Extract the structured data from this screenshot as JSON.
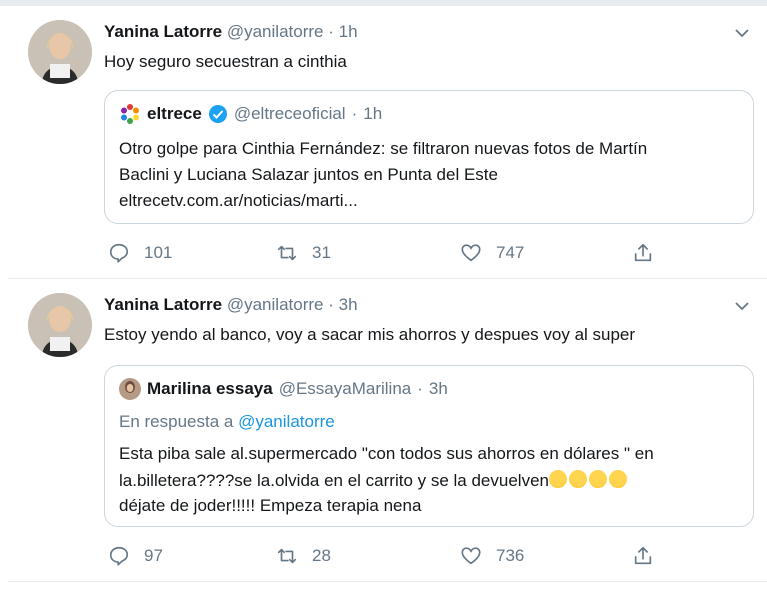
{
  "tweets": [
    {
      "author_name": "Yanina Latorre",
      "handle": "@yanilatorre",
      "time": "1h",
      "text": "Hoy seguro secuestran a cinthia",
      "quote": {
        "author_name": "eltrece",
        "handle": "@eltreceoficial",
        "time": "1h",
        "verified": true,
        "lines": [
          "Otro golpe para Cinthia Fernández: se filtraron nuevas fotos de Martín",
          "Baclini y Luciana Salazar juntos en Punta del Este",
          "eltrecetv.com.ar/noticias/marti..."
        ]
      },
      "replies": "101",
      "retweets": "31",
      "likes": "747"
    },
    {
      "author_name": "Yanina Latorre",
      "handle": "@yanilatorre",
      "time": "3h",
      "text": "Estoy yendo al banco, voy a sacar mis ahorros y despues voy al super",
      "quote": {
        "author_name": "Marilina essaya",
        "handle": "@EssayaMarilina",
        "time": "3h",
        "reply_prefix": "En respuesta a",
        "reply_to": "@yanilatorre",
        "lines": [
          "Esta piba sale al.supermercado \"con todos sus ahorros en dólares \" en",
          "la.billetera????se la.olvida en el carrito y se la devuelven",
          "déjate de joder!!!!! Empeza terapia nena"
        ],
        "emoji": "rofl-emoji x4"
      },
      "replies": "97",
      "retweets": "28",
      "likes": "736"
    }
  ],
  "meta_separator": "·",
  "colors": {
    "text": "#14171a",
    "secondary": "#657786",
    "link": "#1b95e0",
    "border": "#ccd6dd",
    "verified": "#1da1f2"
  }
}
